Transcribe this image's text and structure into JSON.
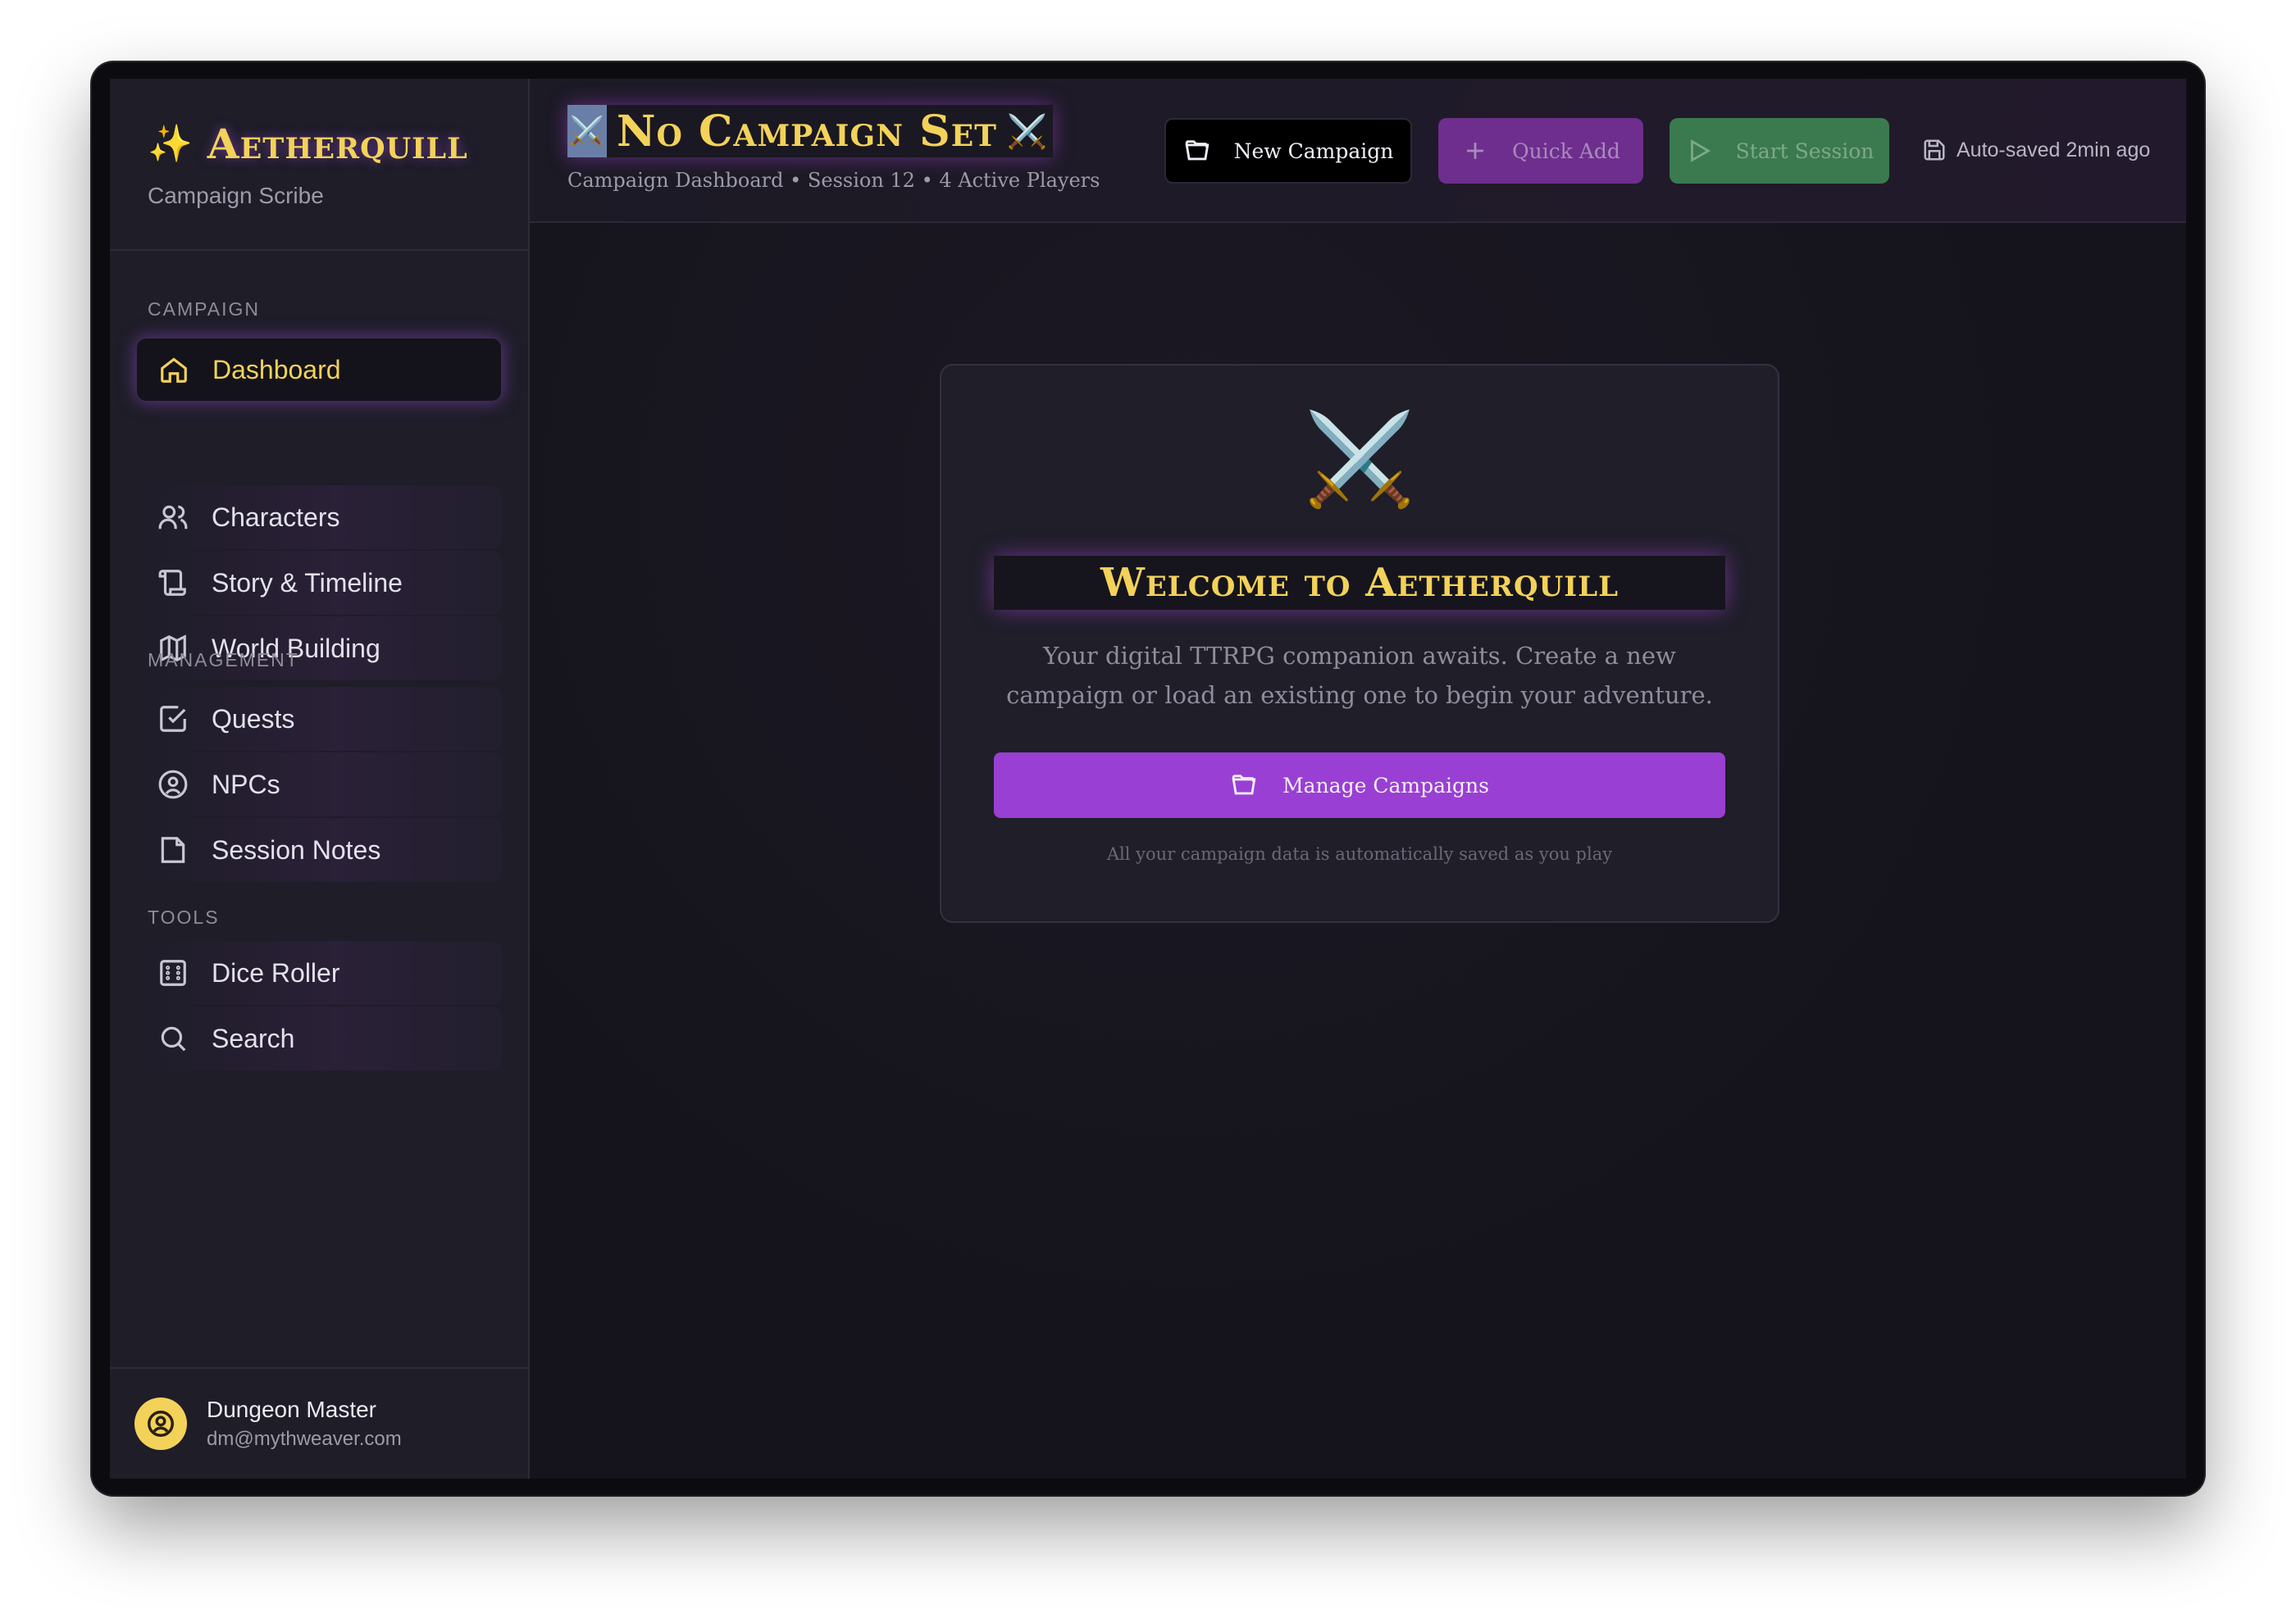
{
  "brand": {
    "name": "Aetherquill",
    "subtitle": "Campaign Scribe",
    "icon": "sparkles-icon"
  },
  "sections": {
    "campaign": "CAMPAIGN",
    "management": "MANAGEMENT",
    "tools": "TOOLS"
  },
  "nav": {
    "dashboard": "Dashboard",
    "characters": "Characters",
    "story": "Story & Timeline",
    "world": "World Building",
    "quests": "Quests",
    "npcs": "NPCs",
    "session_notes": "Session Notes",
    "dice": "Dice Roller",
    "search": "Search"
  },
  "user": {
    "name": "Dungeon Master",
    "email": "dm@mythweaver.com"
  },
  "header": {
    "title": "No Campaign Set",
    "subtitle": "Campaign Dashboard • Session 12 • 4 Active Players",
    "new_campaign": "New Campaign",
    "quick_add": "Quick Add",
    "start_session": "Start Session",
    "autosave": "Auto-saved 2min ago"
  },
  "welcome": {
    "title": "Welcome to Aetherquill",
    "description": "Your digital TTRPG companion awaits. Create a new campaign or load an existing one to begin your adventure.",
    "button": "Manage Campaigns",
    "note": "All your campaign data is automatically saved as you play"
  },
  "colors": {
    "accent_gold": "#f3d25a",
    "accent_purple": "#9a3fd3",
    "start_green": "#3b7a4e"
  }
}
